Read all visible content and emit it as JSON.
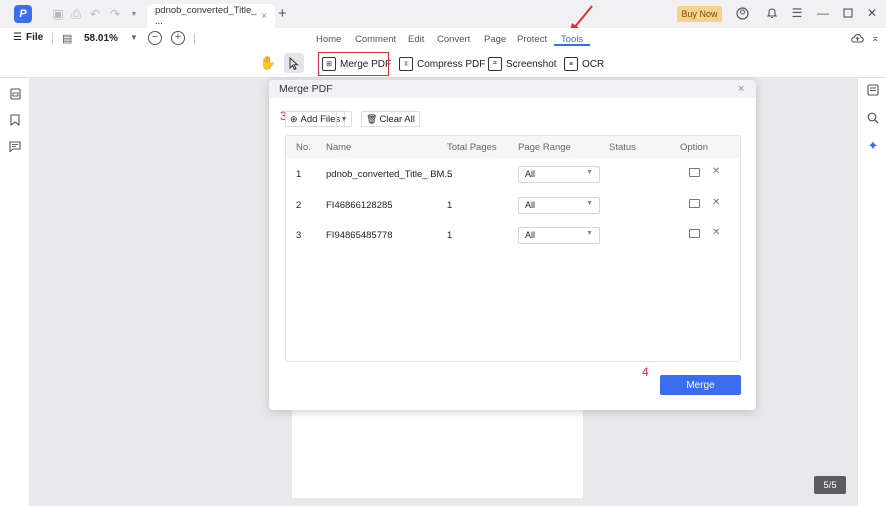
{
  "titlebar": {
    "doc_tab_title": "pdnob_converted_Title_ ...",
    "doc_tab_close": "×",
    "new_tab": "+",
    "buy_now": "Buy Now"
  },
  "menubar": {
    "file_label": "File",
    "zoom_value": "58.01%",
    "tabs": [
      "Home",
      "Comment",
      "Edit",
      "Convert",
      "Page",
      "Protect",
      "Tools"
    ],
    "active_tab": "Tools"
  },
  "toolbar": {
    "merge_pdf": "Merge PDF",
    "compress_pdf": "Compress PDF",
    "screenshot": "Screenshot",
    "ocr": "OCR"
  },
  "dialog": {
    "title": "Merge PDF",
    "close": "×",
    "step3": "3",
    "step4": "4",
    "add_files": "Add Files",
    "clear_all": "Clear All",
    "columns": [
      "No.",
      "Name",
      "Total Pages",
      "Page Range",
      "Status",
      "Option"
    ],
    "rows": [
      {
        "no": "1",
        "name": "pdnob_converted_Title_ BM...",
        "pages": "5",
        "range": "All",
        "status": ""
      },
      {
        "no": "2",
        "name": "FI46866128285",
        "pages": "1",
        "range": "All",
        "status": ""
      },
      {
        "no": "3",
        "name": "FI94865485778",
        "pages": "1",
        "range": "All",
        "status": ""
      }
    ],
    "merge_button": "Merge"
  },
  "page_counter": "5/5",
  "colors": {
    "accent": "#3a6df0",
    "annotation_red": "#e03030",
    "buy_now_bg": "#f5d28a"
  }
}
